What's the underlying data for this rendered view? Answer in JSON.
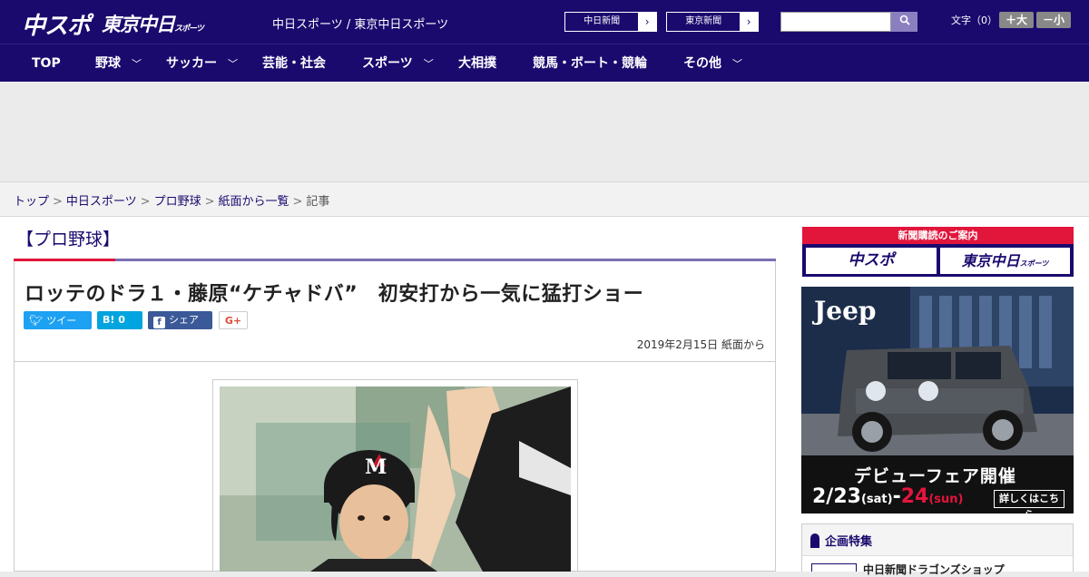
{
  "header": {
    "logo": "中スポ",
    "logo_secondary": "東京中日",
    "logo_secondary_small": "スポーツ",
    "site_link": "中日スポーツ / 東京中日スポーツ",
    "paper_links": [
      "中日新聞",
      "東京新聞"
    ],
    "search_placeholder": "",
    "font_size_label": "文字（0）",
    "font_bigger": "＋大",
    "font_smaller": "－小"
  },
  "nav": {
    "items": [
      {
        "label": "TOP",
        "has_menu": false
      },
      {
        "label": "野球",
        "has_menu": true
      },
      {
        "label": "サッカー",
        "has_menu": true
      },
      {
        "label": "芸能・社会",
        "has_menu": false
      },
      {
        "label": "スポーツ",
        "has_menu": true
      },
      {
        "label": "大相撲",
        "has_menu": false
      },
      {
        "label": "競馬・ボート・競輪",
        "has_menu": false
      },
      {
        "label": "その他",
        "has_menu": true
      }
    ]
  },
  "breadcrumb": {
    "links": [
      "トップ",
      "中日スポーツ",
      "プロ野球",
      "紙面から一覧"
    ],
    "current": "記事",
    "separator": ">"
  },
  "article": {
    "category": "【プロ野球】",
    "headline": "ロッテのドラ１・藤原“ケチャドバ”　初安打から一気に猛打ショー",
    "share": {
      "tweet": "ツイート",
      "hatena": "B! 0",
      "facebook": "シェア 0",
      "gplus": "G+"
    },
    "dateline": "2019年2月15日 紙面から"
  },
  "sidebar": {
    "subscribe_banner": {
      "title": "新聞購読のご案内",
      "left": "中スポ",
      "right": "東京中日",
      "right_small": "スポーツ"
    },
    "ad": {
      "brand": "Jeep",
      "headline": "デビューフェア開催",
      "date_start": "2/",
      "date_day1": "23",
      "date_dow1": "(sat)",
      "date_sep": "-",
      "date_day2": "24",
      "date_dow2": "(sun)",
      "more": "詳しくはこちら"
    },
    "feature": {
      "title": "企画特集",
      "item": "中日新聞ドラゴンズショップ"
    }
  },
  "colors": {
    "brand_navy": "#1a0a6e",
    "accent_red": "#e2153b",
    "accent_purple": "#7b6fb3",
    "twitter": "#1da1f2",
    "hatena": "#00a4de",
    "facebook": "#3b5998"
  },
  "icons": {
    "search": "search-icon",
    "chevron": "chevron-down-icon",
    "arrow": "chevron-right-icon"
  }
}
